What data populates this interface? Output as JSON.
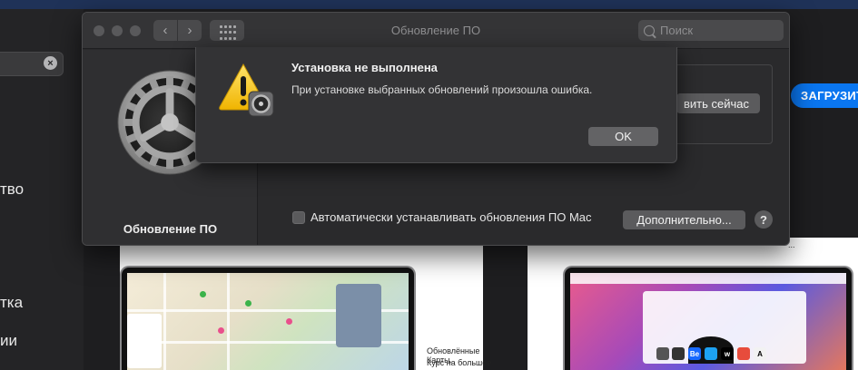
{
  "window": {
    "title": "Обновление ПО",
    "search_placeholder": "Поиск"
  },
  "pane": {
    "label": "Обновление ПО",
    "update_button": "вить сейчас",
    "auto_update_label": "Автоматически устанавливать обновления ПО Mac",
    "auto_update_checked": false,
    "more_button": "Дополнительно...",
    "help_button": "?"
  },
  "alert": {
    "title": "Установка не выполнена",
    "message": "При установке выбранных обновлений произошла ошибка.",
    "ok_button": "OK"
  },
  "background": {
    "sidebar_items": [
      "тво",
      "тка",
      "ии"
    ],
    "download_button": "ЗАГРУЗИТ",
    "card_caption_line1": "Обновлённые Карты.",
    "card_caption_line2": "Курс на большее"
  },
  "colors": {
    "accent": "#0a76f0",
    "warning": "#f4c20d"
  },
  "icons": [
    "close-icon",
    "chevron-left-icon",
    "chevron-right-icon",
    "grid-icon",
    "search-icon",
    "gear-icon",
    "warning-icon",
    "clear-icon"
  ]
}
